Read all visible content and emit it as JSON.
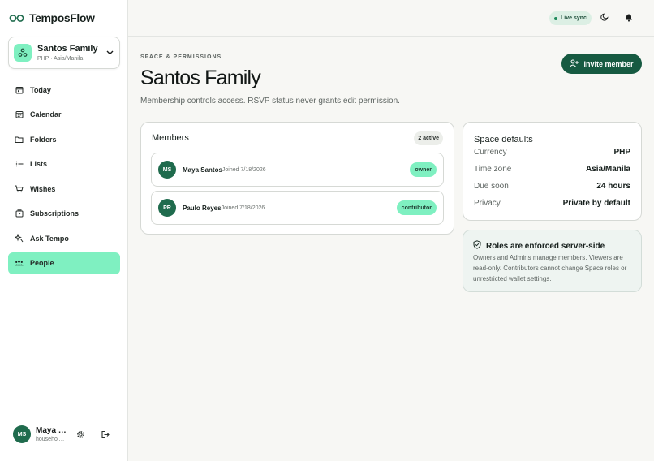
{
  "brand": {
    "name": "TemposFlow"
  },
  "space_switcher": {
    "name": "Santos Family",
    "subtitle": "PHP · Asia/Manila"
  },
  "nav": [
    {
      "label": "Today",
      "icon": "calendar-day-icon",
      "active": false
    },
    {
      "label": "Calendar",
      "icon": "calendar-icon",
      "active": false
    },
    {
      "label": "Folders",
      "icon": "folder-icon",
      "active": false
    },
    {
      "label": "Lists",
      "icon": "list-icon",
      "active": false
    },
    {
      "label": "Wishes",
      "icon": "cart-icon",
      "active": false
    },
    {
      "label": "Subscriptions",
      "icon": "subscription-icon",
      "active": false
    },
    {
      "label": "Ask Tempo",
      "icon": "sparkle-icon",
      "active": false
    },
    {
      "label": "People",
      "icon": "people-icon",
      "active": true
    }
  ],
  "user": {
    "initials": "MS",
    "name": "Maya …",
    "subtitle": "househol…"
  },
  "topbar": {
    "sync_label": "Live sync"
  },
  "header": {
    "eyebrow": "SPACE & PERMISSIONS",
    "title": "Santos Family",
    "description": "Membership controls access. RSVP status never grants edit permission.",
    "invite_label": "Invite member"
  },
  "members": {
    "title": "Members",
    "count_label": "2 active",
    "items": [
      {
        "initials": "MS",
        "name": "Maya Santos",
        "joined": "Joined 7/18/2026",
        "role": "owner"
      },
      {
        "initials": "PR",
        "name": "Paulo Reyes",
        "joined": "Joined 7/18/2026",
        "role": "contributor"
      }
    ]
  },
  "defaults": {
    "title": "Space defaults",
    "rows": [
      {
        "label": "Currency",
        "value": "PHP"
      },
      {
        "label": "Time zone",
        "value": "Asia/Manila"
      },
      {
        "label": "Due soon",
        "value": "24 hours"
      },
      {
        "label": "Privacy",
        "value": "Private by default"
      }
    ]
  },
  "roles_note": {
    "title": "Roles are enforced server-side",
    "body": "Owners and Admins manage members. Viewers are read-only. Contributors cannot change Space roles or unrestricted wallet settings."
  },
  "colors": {
    "accent": "#7ff0c1",
    "primary": "#165a41",
    "avatar": "#1f6b4d"
  }
}
